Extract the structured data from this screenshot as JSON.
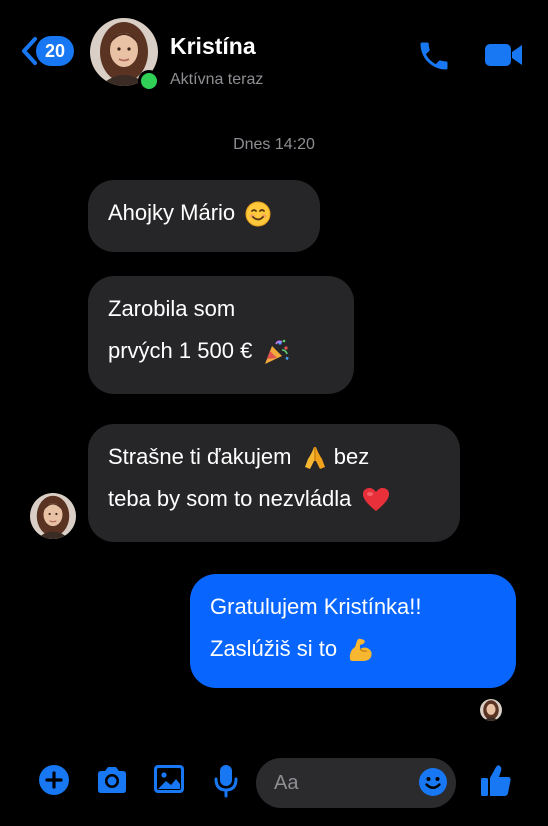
{
  "header": {
    "back_count": "20",
    "contact_name": "Kristína",
    "status": "Aktívna teraz"
  },
  "conversation": {
    "timestamp": "Dnes 14:20",
    "messages": [
      {
        "direction": "incoming",
        "lines": [
          "Ahojky Mário"
        ],
        "emoji": "smiling-face"
      },
      {
        "direction": "incoming",
        "lines": [
          "Zarobila som",
          "prvých 1 500 €"
        ],
        "emoji": "party-popper"
      },
      {
        "direction": "incoming",
        "lines": [
          "Strašne ti ďakujem",
          "teba by som to nezvládla"
        ],
        "line1_suffix": "bez",
        "emoji": "folded-hands, red-heart"
      },
      {
        "direction": "outgoing",
        "lines": [
          "Gratulujem Kristínka!!",
          "Zaslúžiš si to"
        ],
        "emoji": "flexed-biceps"
      }
    ]
  },
  "composer": {
    "placeholder": "Aa"
  },
  "colors": {
    "accent": "#0866ff",
    "background": "#000000",
    "incoming_bubble": "#262628",
    "online": "#31d158"
  }
}
